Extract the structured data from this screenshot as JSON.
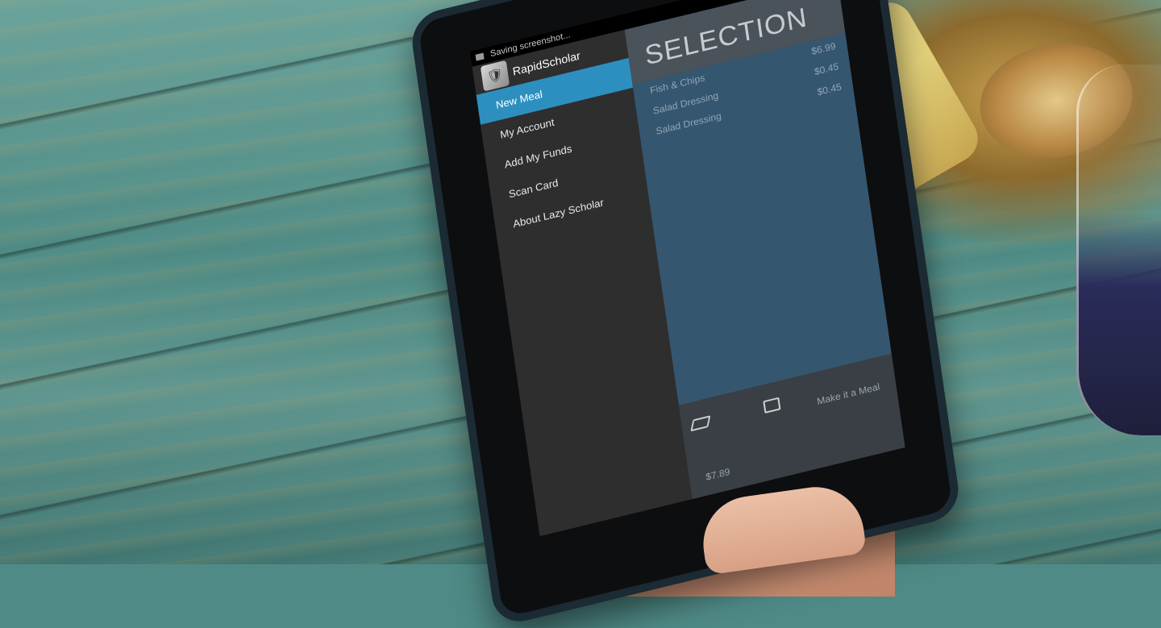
{
  "status_bar": {
    "text": "Saving screenshot..."
  },
  "app": {
    "name": "RapidScholar"
  },
  "drawer": {
    "items": [
      {
        "label": "New Meal",
        "active": true
      },
      {
        "label": "My Account",
        "active": false
      },
      {
        "label": "Add My Funds",
        "active": false
      },
      {
        "label": "Scan Card",
        "active": false
      },
      {
        "label": "About Lazy Scholar",
        "active": false
      }
    ]
  },
  "selection": {
    "title": "SELECTION",
    "items": [
      {
        "name": "Fish & Chips",
        "price": "$6.99"
      },
      {
        "name": "Salad Dressing",
        "price": "$0.45"
      },
      {
        "name": "Salad Dressing",
        "price": "$0.45"
      }
    ],
    "make_meal": "Make it a Meal",
    "total": "$7.89"
  },
  "colors": {
    "accent": "#2d8fc0",
    "list_bg": "#35566f"
  }
}
